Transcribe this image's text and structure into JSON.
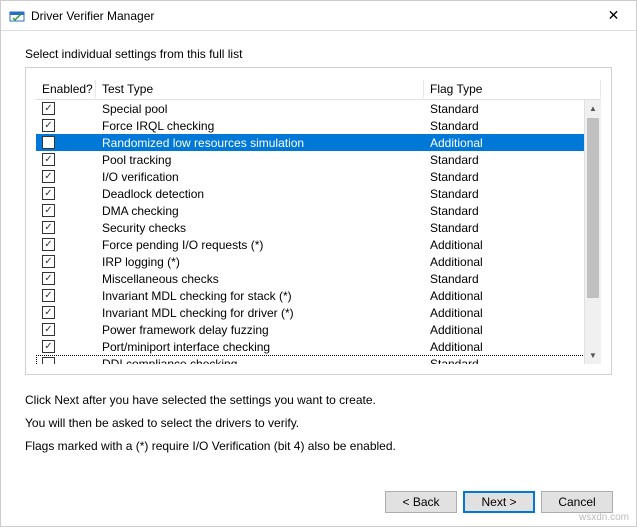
{
  "window": {
    "title": "Driver Verifier Manager"
  },
  "instruction": "Select individual settings from this full list",
  "columns": {
    "enabled": "Enabled?",
    "test": "Test Type",
    "flag": "Flag Type"
  },
  "rows": [
    {
      "checked": true,
      "test": "Special pool",
      "flag": "Standard",
      "selected": false,
      "focused": false
    },
    {
      "checked": true,
      "test": "Force IRQL checking",
      "flag": "Standard",
      "selected": false,
      "focused": false
    },
    {
      "checked": false,
      "test": "Randomized low resources simulation",
      "flag": "Additional",
      "selected": true,
      "focused": false
    },
    {
      "checked": true,
      "test": "Pool tracking",
      "flag": "Standard",
      "selected": false,
      "focused": false
    },
    {
      "checked": true,
      "test": "I/O verification",
      "flag": "Standard",
      "selected": false,
      "focused": false
    },
    {
      "checked": true,
      "test": "Deadlock detection",
      "flag": "Standard",
      "selected": false,
      "focused": false
    },
    {
      "checked": true,
      "test": "DMA checking",
      "flag": "Standard",
      "selected": false,
      "focused": false
    },
    {
      "checked": true,
      "test": "Security checks",
      "flag": "Standard",
      "selected": false,
      "focused": false
    },
    {
      "checked": true,
      "test": "Force pending I/O requests (*)",
      "flag": "Additional",
      "selected": false,
      "focused": false
    },
    {
      "checked": true,
      "test": "IRP logging (*)",
      "flag": "Additional",
      "selected": false,
      "focused": false
    },
    {
      "checked": true,
      "test": "Miscellaneous checks",
      "flag": "Standard",
      "selected": false,
      "focused": false
    },
    {
      "checked": true,
      "test": "Invariant MDL checking for stack (*)",
      "flag": "Additional",
      "selected": false,
      "focused": false
    },
    {
      "checked": true,
      "test": "Invariant MDL checking for driver (*)",
      "flag": "Additional",
      "selected": false,
      "focused": false
    },
    {
      "checked": true,
      "test": "Power framework delay fuzzing",
      "flag": "Additional",
      "selected": false,
      "focused": false
    },
    {
      "checked": true,
      "test": "Port/miniport interface checking",
      "flag": "Additional",
      "selected": false,
      "focused": false
    },
    {
      "checked": false,
      "test": "DDI compliance checking",
      "flag": "Standard",
      "selected": false,
      "focused": true
    }
  ],
  "notes": {
    "line1": "Click Next after you have selected the settings you want to create.",
    "line2": "You will then be asked to select the drivers to verify.",
    "line3": "Flags marked with a (*) require I/O Verification (bit 4) also be enabled."
  },
  "buttons": {
    "back": "< Back",
    "next": "Next >",
    "cancel": "Cancel"
  },
  "watermark": "wsxdn.com"
}
